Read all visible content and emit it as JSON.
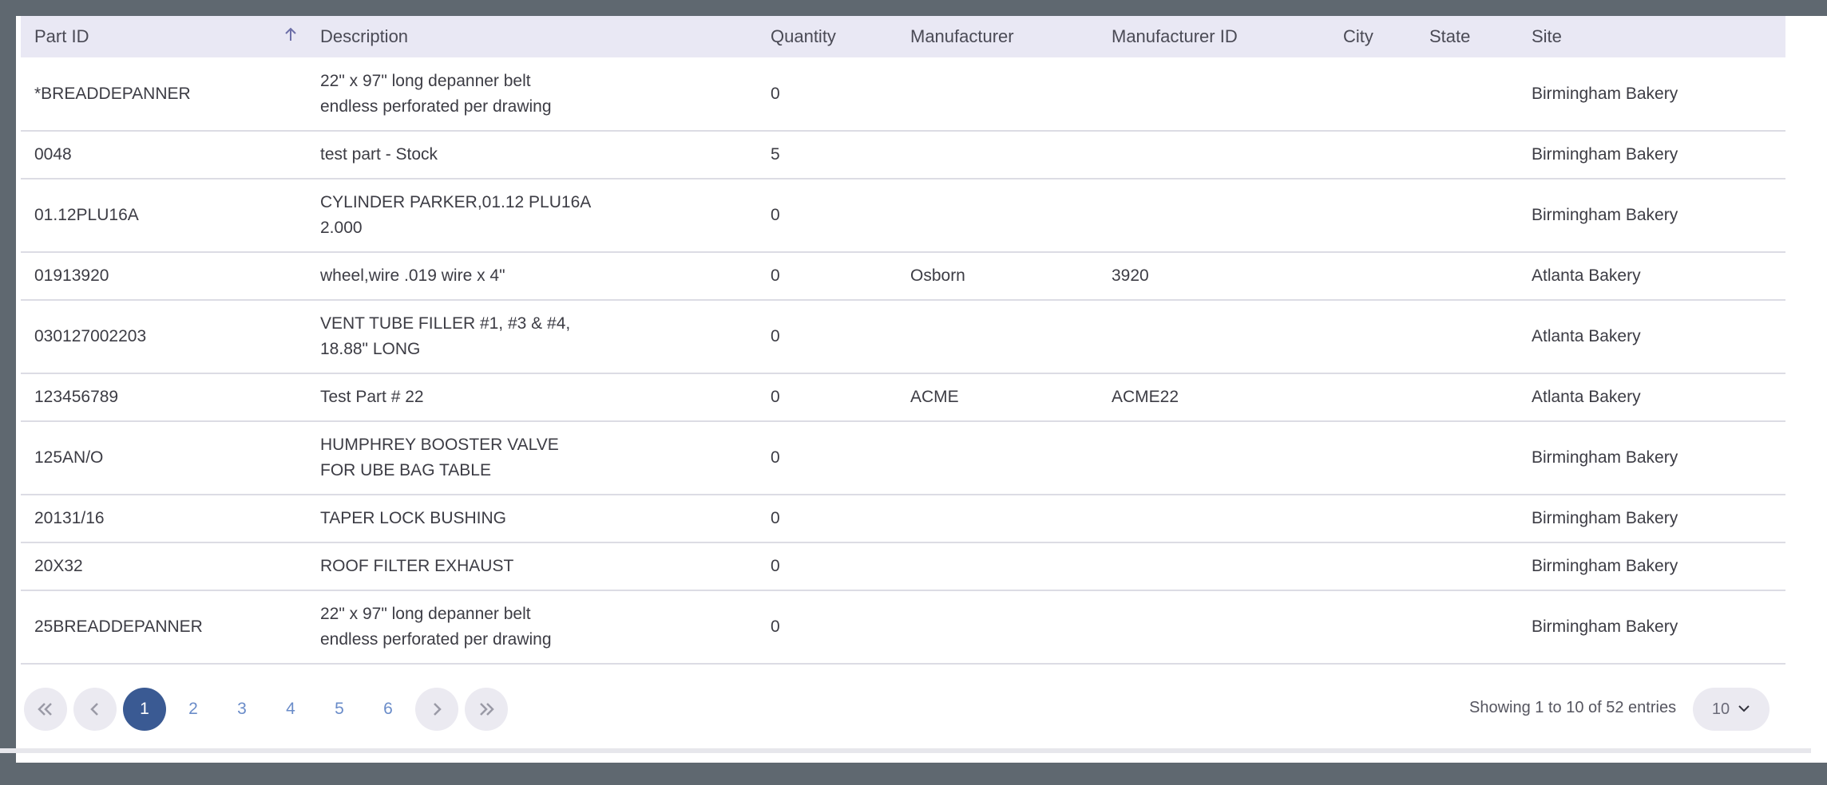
{
  "table": {
    "columns": [
      {
        "label": "Part ID",
        "sorted": "asc"
      },
      {
        "label": "Description"
      },
      {
        "label": "Quantity"
      },
      {
        "label": "Manufacturer"
      },
      {
        "label": "Manufacturer ID"
      },
      {
        "label": "City"
      },
      {
        "label": "State"
      },
      {
        "label": "Site"
      }
    ],
    "rows": [
      {
        "part_id": "*BREADDEPANNER",
        "description": "22\" x 97\" long depanner belt endless perforated per drawing",
        "quantity": "0",
        "manufacturer": "",
        "manufacturer_id": "",
        "city": "",
        "state": "",
        "site": "Birmingham Bakery"
      },
      {
        "part_id": "0048",
        "description": "test part - Stock",
        "quantity": "5",
        "manufacturer": "",
        "manufacturer_id": "",
        "city": "",
        "state": "",
        "site": "Birmingham Bakery"
      },
      {
        "part_id": "01.12PLU16A",
        "description": "CYLINDER PARKER,01.12 PLU16A 2.000",
        "quantity": "0",
        "manufacturer": "",
        "manufacturer_id": "",
        "city": "",
        "state": "",
        "site": "Birmingham Bakery"
      },
      {
        "part_id": "01913920",
        "description": "wheel,wire .019 wire x 4\"",
        "quantity": "0",
        "manufacturer": "Osborn",
        "manufacturer_id": "3920",
        "city": "",
        "state": "",
        "site": "Atlanta Bakery"
      },
      {
        "part_id": "030127002203",
        "description": "VENT TUBE FILLER #1, #3 & #4, 18.88\" LONG",
        "quantity": "0",
        "manufacturer": "",
        "manufacturer_id": "",
        "city": "",
        "state": "",
        "site": "Atlanta Bakery"
      },
      {
        "part_id": "123456789",
        "description": "Test Part # 22",
        "quantity": "0",
        "manufacturer": "ACME",
        "manufacturer_id": "ACME22",
        "city": "",
        "state": "",
        "site": "Atlanta Bakery"
      },
      {
        "part_id": "125AN/O",
        "description": "HUMPHREY BOOSTER VALVE FOR UBE BAG TABLE",
        "quantity": "0",
        "manufacturer": "",
        "manufacturer_id": "",
        "city": "",
        "state": "",
        "site": "Birmingham Bakery"
      },
      {
        "part_id": "20131/16",
        "description": "TAPER LOCK BUSHING",
        "quantity": "0",
        "manufacturer": "",
        "manufacturer_id": "",
        "city": "",
        "state": "",
        "site": "Birmingham Bakery"
      },
      {
        "part_id": "20X32",
        "description": "ROOF FILTER EXHAUST",
        "quantity": "0",
        "manufacturer": "",
        "manufacturer_id": "",
        "city": "",
        "state": "",
        "site": "Birmingham Bakery"
      },
      {
        "part_id": "25BREADDEPANNER",
        "description": "22\" x 97\" long depanner belt endless perforated per drawing",
        "quantity": "0",
        "manufacturer": "",
        "manufacturer_id": "",
        "city": "",
        "state": "",
        "site": "Birmingham Bakery"
      }
    ]
  },
  "pagination": {
    "first_icon": "double-chevron-left-icon",
    "prev_icon": "chevron-left-icon",
    "next_icon": "chevron-right-icon",
    "last_icon": "double-chevron-right-icon",
    "pages": [
      "1",
      "2",
      "3",
      "4",
      "5",
      "6"
    ],
    "active_page": "1",
    "summary": "Showing 1 to 10 of 52 entries",
    "page_size": "10"
  },
  "colors": {
    "header_bg": "#e9e8f4",
    "active_page_bg": "#3a5a93",
    "page_link": "#6a8cc9",
    "backdrop": "#5f6870"
  }
}
